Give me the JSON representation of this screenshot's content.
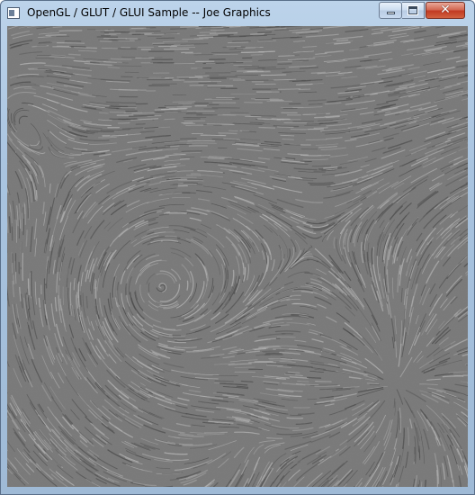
{
  "window": {
    "title": "OpenGL / GLUT / GLUI Sample -- Joe Graphics",
    "app_icon": "application-window-icon",
    "controls": {
      "minimize_icon": "minimize-icon",
      "maximize_icon": "maximize-icon",
      "close_icon": "close-icon",
      "close_glyph": "✕"
    }
  },
  "canvas": {
    "content": "line-integral-convolution-flow-visualization",
    "colors": {
      "base": "#7b7b7b",
      "streak_light": "#c8c8c8",
      "streak_dark": "#3e3e3e",
      "frame": "#a9c4e0",
      "close_button": "#c23a22"
    }
  }
}
